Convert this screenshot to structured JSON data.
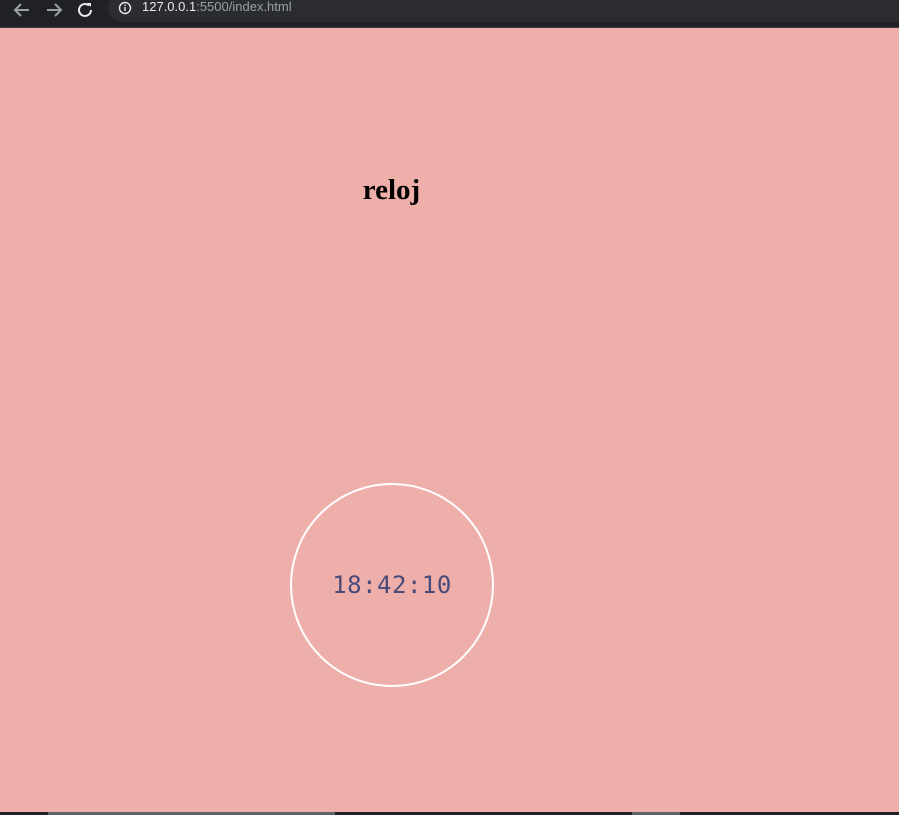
{
  "browser": {
    "url_host": "127.0.0.1",
    "url_rest": ":5500/index.html",
    "icons": {
      "back": "arrow-left-icon",
      "forward": "arrow-right-icon",
      "reload": "reload-icon",
      "info": "info-icon"
    }
  },
  "page": {
    "title": "reloj",
    "clock_time": "18:42:10",
    "colors": {
      "background": "#eeafaa",
      "clock_border": "#ffffff",
      "clock_text": "#4a4a78"
    }
  }
}
